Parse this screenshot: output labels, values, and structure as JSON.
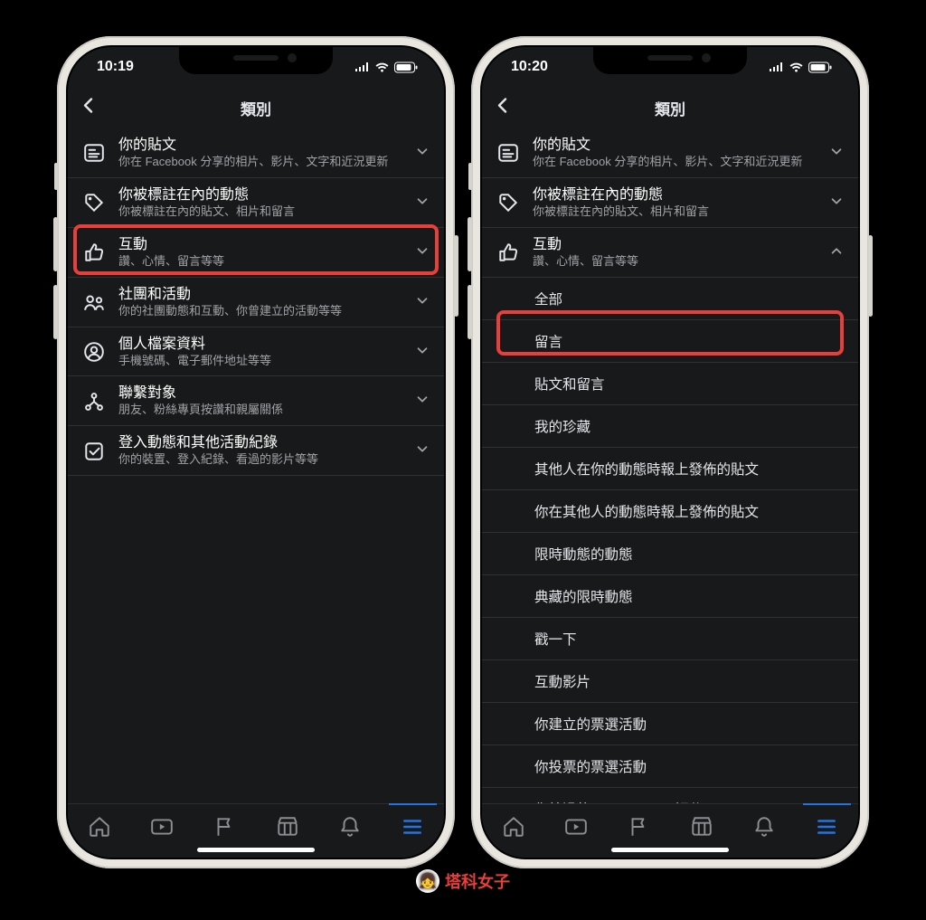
{
  "watermark": "塔科女子",
  "status_time_left": "10:19",
  "status_time_right": "10:20",
  "header_title": "類別",
  "categories": [
    {
      "key": "posts",
      "title": "你的貼文",
      "sub": "你在 Facebook 分享的相片、影片、文字和近況更新"
    },
    {
      "key": "tagged",
      "title": "你被標註在內的動態",
      "sub": "你被標註在內的貼文、相片和留言"
    },
    {
      "key": "interact",
      "title": "互動",
      "sub": "讚、心情、留言等等"
    },
    {
      "key": "groups",
      "title": "社團和活動",
      "sub": "你的社團動態和互動、你曾建立的活動等等"
    },
    {
      "key": "profile",
      "title": "個人檔案資料",
      "sub": "手機號碼、電子郵件地址等等"
    },
    {
      "key": "connect",
      "title": "聯繫對象",
      "sub": "朋友、粉絲專頁按讚和親屬關係"
    },
    {
      "key": "logins",
      "title": "登入動態和其他活動紀錄",
      "sub": "你的裝置、登入紀錄、看過的影片等等"
    }
  ],
  "interact_sub": [
    "全部",
    "留言",
    "貼文和留言",
    "我的珍藏",
    "其他人在你的動態時報上發佈的貼文",
    "你在其他人的動態時報上發佈的貼文",
    "限時動態的動態",
    "典藏的限時動態",
    "戳一下",
    "互動影片",
    "你建立的票選活動",
    "你投票的票選活動",
    "你給過的 Marketplace 評分"
  ]
}
